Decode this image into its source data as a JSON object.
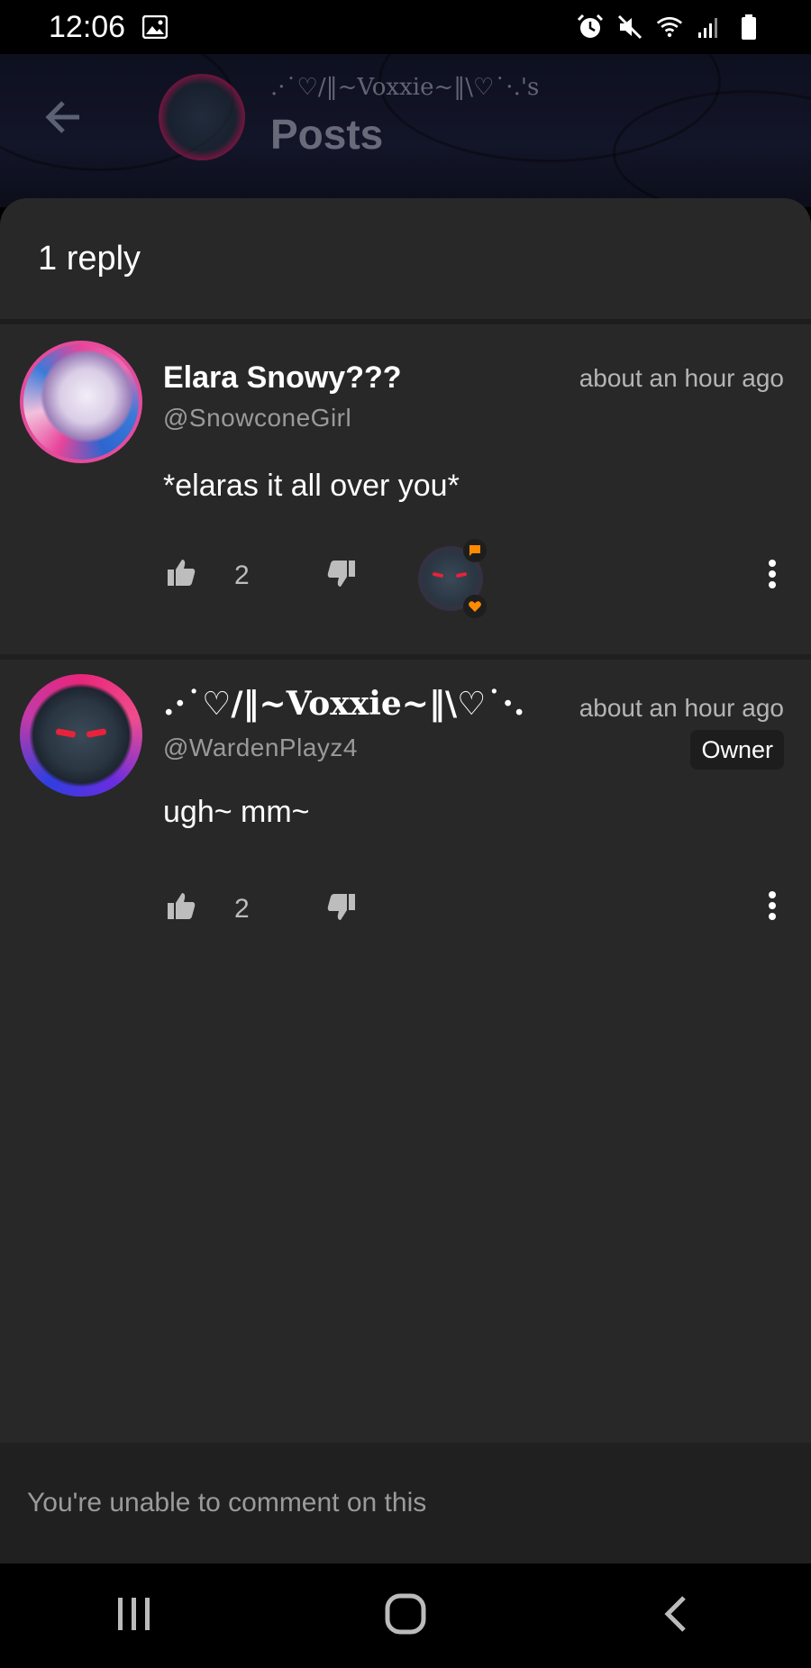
{
  "status_bar": {
    "time": "12:06",
    "icons": [
      "image-icon",
      "alarm-icon",
      "mute-icon",
      "wifi-icon",
      "signal-icon",
      "battery-icon"
    ]
  },
  "header": {
    "owner_name": ".·˙♡/‖~Voxxie~‖\\♡˙·.'s",
    "title": "Posts"
  },
  "sheet": {
    "reply_count_label": "1 reply"
  },
  "comments": [
    {
      "username": "Elara Snowy???",
      "handle": "@SnowconeGirl",
      "timestamp": "about an hour ago",
      "text": "*elaras it all over you*",
      "likes": "2",
      "reactor_badges": [
        "chat-badge-icon",
        "heart-badge-icon"
      ]
    },
    {
      "username": ".·˙♡/‖~Voxxie~‖\\♡˙·.",
      "handle": "@WardenPlayz4",
      "timestamp": "about an hour ago",
      "badge": "Owner",
      "text": "ugh~ mm~",
      "likes": "2"
    }
  ],
  "footer": {
    "disabled_message": "You're unable to comment on this"
  },
  "colors": {
    "sheet_bg": "#282828",
    "accent_orange": "#ff8a00",
    "header_bg": "#1a1e3a"
  }
}
